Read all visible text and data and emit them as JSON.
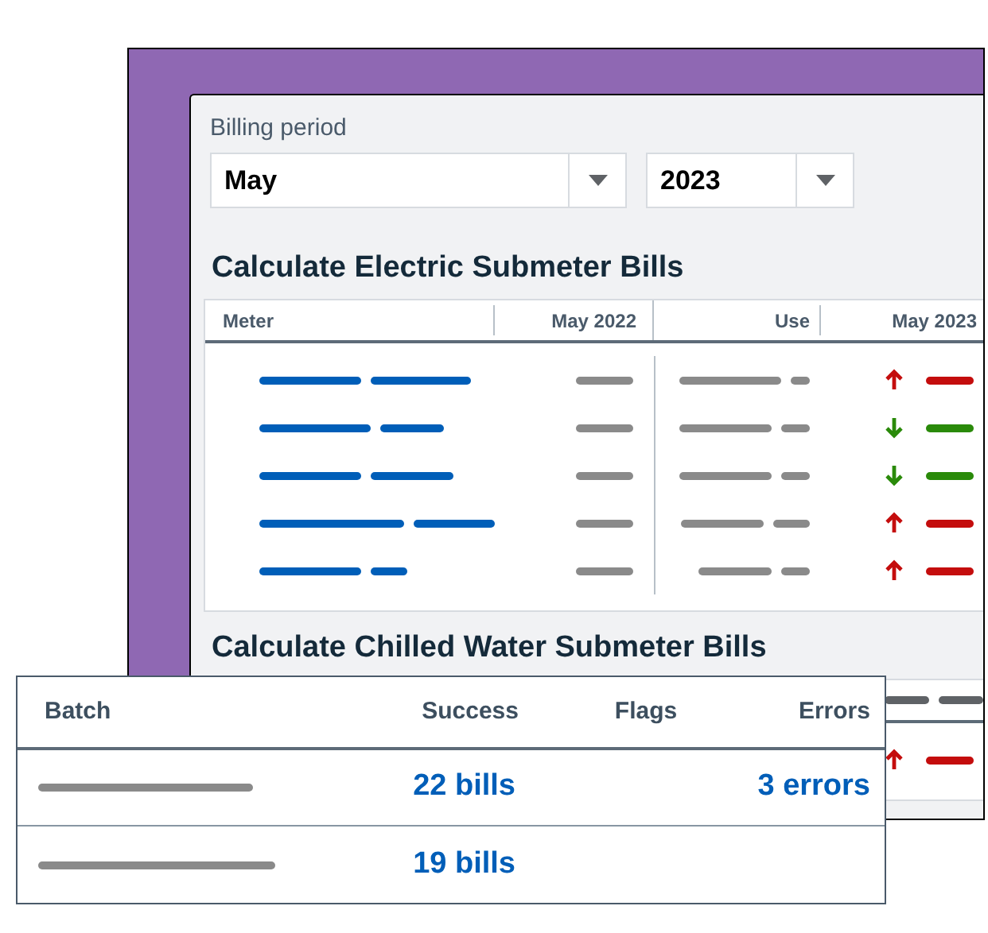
{
  "billing_period": {
    "label": "Billing period",
    "month": "May",
    "year": "2023"
  },
  "sections": [
    {
      "title": "Calculate Electric Submeter Bills",
      "columns": [
        "Meter",
        "May 2022",
        "Use",
        "May 2023"
      ],
      "rows": [
        {
          "rising": true
        },
        {
          "rising": false
        },
        {
          "rising": false
        },
        {
          "rising": true
        },
        {
          "rising": true
        }
      ]
    },
    {
      "title": "Calculate Chilled Water Submeter Bills",
      "rows": [
        {
          "rising": true
        }
      ]
    }
  ],
  "batches": {
    "columns": [
      "Batch",
      "Success",
      "Flags",
      "Errors"
    ],
    "rows": [
      {
        "success": "22 bills",
        "errors": "3 errors"
      },
      {
        "success": "19 bills"
      }
    ]
  }
}
